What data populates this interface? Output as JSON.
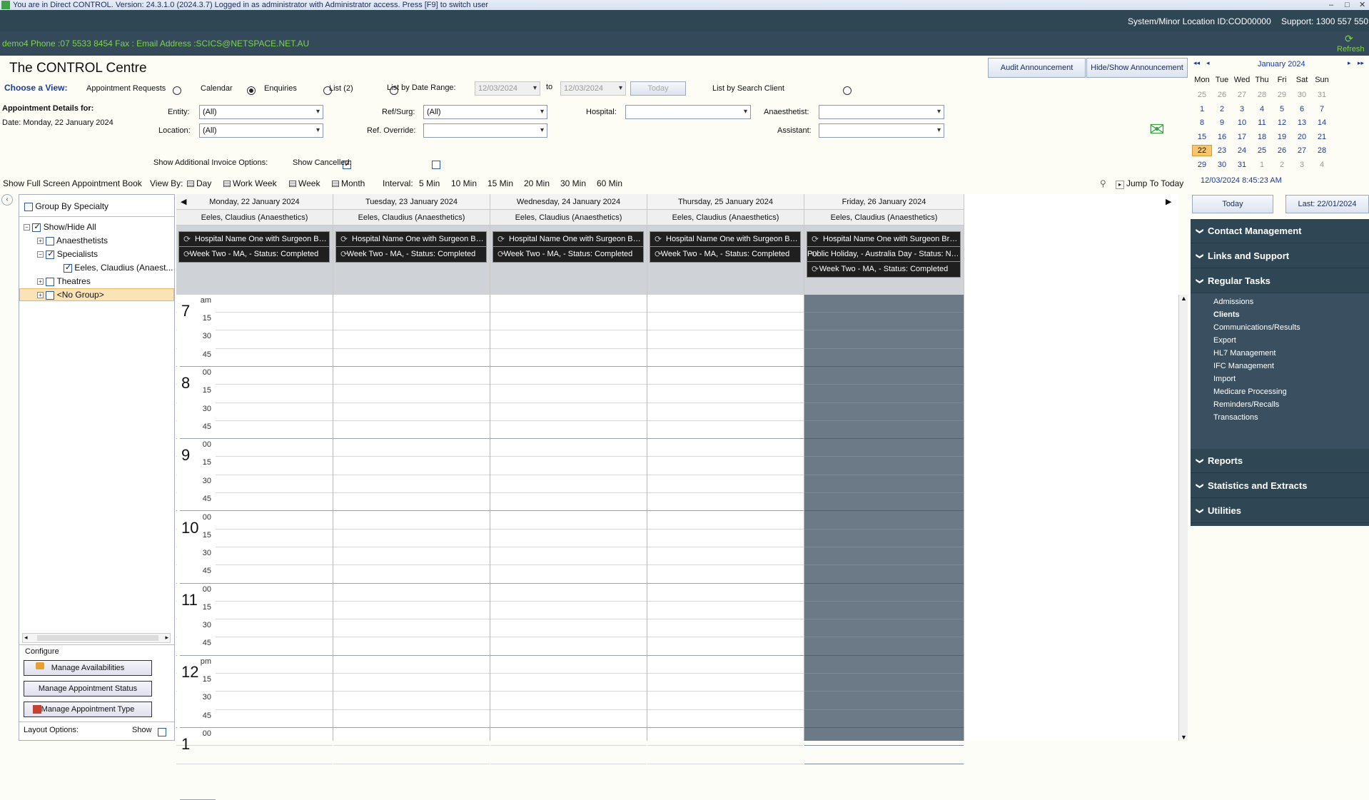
{
  "titlebar": {
    "text": "You are in Direct CONTROL. Version: 24.3.1.0 (2024.3.7) Logged in as administrator with Administrator access. Press [F9] to switch user",
    "min": "–",
    "max": "□",
    "close": "✕"
  },
  "topbar": {
    "location": "System/Minor Location ID:COD00000",
    "support": "Support: 1300 557 550",
    "client_info": "demo4  Phone :07 5533 8454  Fax :  Email Address :SCICS@NETSPACE.NET.AU",
    "refresh": "Refresh"
  },
  "header": {
    "title": "The CONTROL Centre",
    "choose_view": "Choose a View:",
    "views": [
      "Appointment Requests",
      "Calendar",
      "Enquiries",
      "List (2)"
    ],
    "list_by_date": "List by Date Range:",
    "date_from": "12/03/2024",
    "to": "to",
    "date_to": "12/03/2024",
    "today": "Today",
    "list_by_client": "List by Search Client",
    "audit_btn": "Audit Announcement",
    "hideshow_btn": "Hide/Show Announcement"
  },
  "details": {
    "label": "Appointment Details for:",
    "date": "Date: Monday, 22 January 2024",
    "entity_label": "Entity:",
    "entity_value": "(All)",
    "location_label": "Location:",
    "location_value": "(All)",
    "refsurg_label": "Ref/Surg:",
    "refsurg_value": "(All)",
    "refoverride_label": "Ref. Override:",
    "hospital_label": "Hospital:",
    "anaesthetist_label": "Anaesthetist:",
    "assistant_label": "Assistant:",
    "show_invoice": "Show Additional Invoice Options:",
    "show_cancelled": "Show Cancelled:"
  },
  "toolbar": {
    "fullscreen": "Show Full Screen Appointment Book",
    "viewby": "View By:",
    "day": "Day",
    "workweek": "Work Week",
    "week": "Week",
    "month": "Month",
    "interval": "Interval:",
    "intervals": [
      "5 Min",
      "10 Min",
      "15 Min",
      "20 Min",
      "30 Min",
      "60 Min"
    ],
    "jump": "Jump To Today"
  },
  "left": {
    "group_specialty": "Group By Specialty",
    "showhide": "Show/Hide All",
    "anaesthetists": "Anaesthetists",
    "specialists": "Specialists",
    "eeles": "Eeles, Claudius (Anaest...",
    "theatres": "Theatres",
    "nogroup": "<No Group>",
    "configure": "Configure",
    "manage_avail": "Manage Availabilities",
    "manage_status": "Manage Appointment Status",
    "manage_type": "Manage Appointment Type",
    "layout": "Layout Options:",
    "show": "Show"
  },
  "calendar": {
    "days": [
      {
        "date": "Monday, 22 January 2024",
        "resource": "Eeles, Claudius (Anaesthetics)",
        "events": [
          "Hospital Name One with Surgeon Brenda Ree...",
          "Week Two - MA,  - Status: Completed"
        ]
      },
      {
        "date": "Tuesday, 23 January 2024",
        "resource": "Eeles, Claudius (Anaesthetics)",
        "events": [
          "Hospital Name One with Surgeon Brenda Ree...",
          "Week Two - MA,  - Status: Completed"
        ]
      },
      {
        "date": "Wednesday, 24 January 2024",
        "resource": "Eeles, Claudius (Anaesthetics)",
        "events": [
          "Hospital Name One with Surgeon Brenda Ree...",
          "Week Two - MA,  - Status: Completed"
        ]
      },
      {
        "date": "Thursday, 25 January 2024",
        "resource": "Eeles, Claudius (Anaesthetics)",
        "events": [
          "Hospital Name One with Surgeon Brenda Ree...",
          "Week Two - MA,  - Status: Completed"
        ]
      },
      {
        "date": "Friday, 26 January 2024",
        "resource": "Eeles, Claudius (Anaesthetics)",
        "events": [
          "Hospital Name One with Surgeon Brenda Ree...",
          "Public Holiday,  - Australia Day - Status: Normal",
          "Week Two - MA,  - Status: Completed"
        ]
      }
    ],
    "hours": [
      {
        "h": "7",
        "ap": "am"
      },
      {
        "h": "8",
        "ap": "00"
      },
      {
        "h": "9",
        "ap": "00"
      },
      {
        "h": "10",
        "ap": "00"
      },
      {
        "h": "11",
        "ap": "00"
      },
      {
        "h": "12",
        "ap": "pm"
      },
      {
        "h": "1",
        "ap": "00"
      }
    ],
    "minutes": [
      "15",
      "30",
      "45"
    ]
  },
  "minical": {
    "month": "January 2024",
    "weekdays": [
      "Mon",
      "Tue",
      "Wed",
      "Thu",
      "Fri",
      "Sat",
      "Sun"
    ],
    "weeks": [
      [
        "25",
        "26",
        "27",
        "28",
        "29",
        "30",
        "31"
      ],
      [
        "1",
        "2",
        "3",
        "4",
        "5",
        "6",
        "7"
      ],
      [
        "8",
        "9",
        "10",
        "11",
        "12",
        "13",
        "14"
      ],
      [
        "15",
        "16",
        "17",
        "18",
        "19",
        "20",
        "21"
      ],
      [
        "22",
        "23",
        "24",
        "25",
        "26",
        "27",
        "28"
      ],
      [
        "29",
        "30",
        "31",
        "1",
        "2",
        "3",
        "4"
      ]
    ],
    "selected": "22",
    "timestamp": "12/03/2024 8:45:23 AM",
    "today_btn": "Today",
    "last_btn": "Last: 22/01/2024"
  },
  "accordion": {
    "contact": "Contact Management",
    "links": "Links and Support",
    "regular": "Regular Tasks",
    "regular_items": [
      "Admissions",
      "Clients",
      "Communications/Results",
      "Export",
      "HL7 Management",
      "IFC Management",
      "Import",
      "Medicare Processing",
      "Reminders/Recalls",
      "Transactions"
    ],
    "reports": "Reports",
    "stats": "Statistics and Extracts",
    "utilities": "Utilities"
  },
  "colors": {
    "dark": "#2f4654",
    "green": "#7fd34a",
    "selected_day": "#f7c66b",
    "holiday_col": "#6c7a88"
  }
}
